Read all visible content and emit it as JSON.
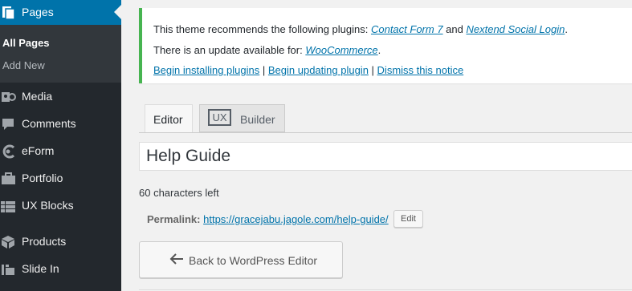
{
  "sidebar": {
    "active": {
      "label": "Pages",
      "icon": "pages-icon"
    },
    "submenu": [
      {
        "label": "All Pages",
        "current": true
      },
      {
        "label": "Add New",
        "current": false
      }
    ],
    "items": [
      {
        "label": "Media",
        "icon": "media-icon"
      },
      {
        "label": "Comments",
        "icon": "comments-icon"
      },
      {
        "label": "eForm",
        "icon": "eform-icon"
      },
      {
        "label": "Portfolio",
        "icon": "portfolio-icon"
      },
      {
        "label": "UX Blocks",
        "icon": "ux-blocks-icon"
      },
      {
        "label": "Products",
        "icon": "products-icon"
      },
      {
        "label": "Slide In",
        "icon": "slide-in-icon"
      }
    ]
  },
  "notice": {
    "line1_prefix": "This theme recommends the following plugins: ",
    "plugin1": "Contact Form 7",
    "and": " and ",
    "plugin2": "Nextend Social Login",
    "period": ".",
    "line2_prefix": "There is an update available for: ",
    "plugin3": "WooCommerce",
    "link_install": "Begin installing plugins",
    "separator": " | ",
    "link_update": "Begin updating plugin",
    "link_dismiss": "Dismiss this notice"
  },
  "tabs": {
    "editor": "Editor",
    "ux_badge": "UX",
    "ux_builder": "Builder"
  },
  "title": {
    "value": "Help Guide",
    "chars_left": "60 characters left"
  },
  "permalink": {
    "label": "Permalink:",
    "url": "https://gracejabu.jagole.com/help-guide/",
    "edit": "Edit"
  },
  "back_button": {
    "label": "Back to WordPress Editor",
    "icon": "arrow-left-icon"
  },
  "colors": {
    "sidebar_bg": "#23282d",
    "active_bg": "#0073aa",
    "notice_border": "#46b450",
    "link": "#0073aa"
  }
}
